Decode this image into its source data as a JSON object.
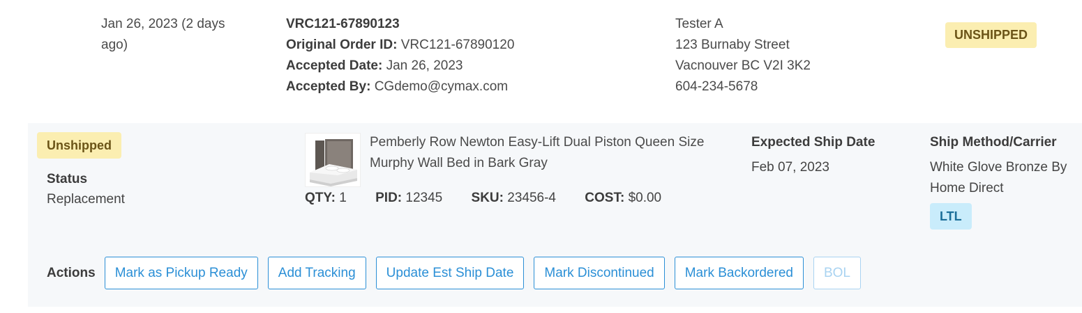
{
  "order": {
    "date": "Jan 26, 2023 (2 days ago)",
    "order_number": "VRC121-67890123",
    "original_order_label": "Original Order ID:",
    "original_order_id": "VRC121-67890120",
    "accepted_date_label": "Accepted Date:",
    "accepted_date": "Jan 26, 2023",
    "accepted_by_label": "Accepted By:",
    "accepted_by": "CGdemo@cymax.com",
    "status": "UNSHIPPED"
  },
  "ship_to": {
    "name": "Tester A",
    "street": "123 Burnaby Street",
    "city": "Vacnouver BC V2I 3K2",
    "phone": "604-234-5678"
  },
  "item": {
    "status_badge": "Unshipped",
    "status_heading": "Status",
    "status_value": "Replacement",
    "product_name": "Pemberly Row Newton Easy-Lift Dual Piston Queen Size Murphy Wall Bed in Bark Gray",
    "product_image_icon": "murphy-bed-thumbnail",
    "qty_label": "QTY:",
    "qty": "1",
    "pid_label": "PID:",
    "pid": "12345",
    "sku_label": "SKU:",
    "sku": "23456-4",
    "cost_label": "COST:",
    "cost": "$0.00",
    "expected_ship_heading": "Expected Ship Date",
    "expected_ship_date": "Feb 07, 2023",
    "carrier_heading": "Ship Method/Carrier",
    "carrier": "White Glove Bronze By Home Direct",
    "carrier_badge": "LTL"
  },
  "actions": {
    "label": "Actions",
    "buttons": [
      {
        "label": "Mark as Pickup Ready",
        "enabled": true
      },
      {
        "label": "Add Tracking",
        "enabled": true
      },
      {
        "label": "Update Est Ship Date",
        "enabled": true
      },
      {
        "label": "Mark Discontinued",
        "enabled": true
      },
      {
        "label": "Mark Backordered",
        "enabled": true
      },
      {
        "label": "BOL",
        "enabled": false
      }
    ]
  },
  "colors": {
    "accent": "#2b8fd6",
    "unshipped_badge_bg": "#fbeeb1",
    "ltl_badge_bg": "#c9ecfb",
    "panel_bg": "#f6f8fa"
  }
}
